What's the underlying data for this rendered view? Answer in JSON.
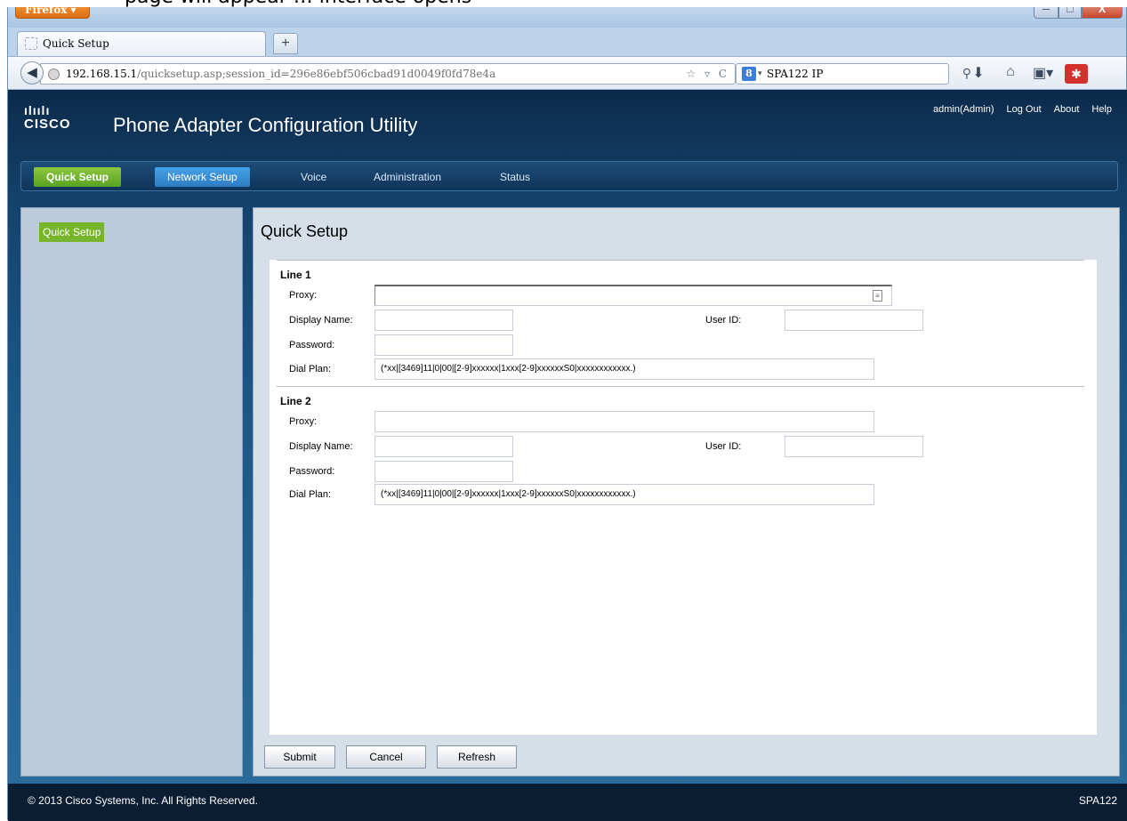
{
  "top_strip": {
    "text": "page will appear … interface opens"
  },
  "browser": {
    "app_button": "Firefox ▾",
    "tab_title": "Quick Setup",
    "new_tab": "+",
    "url_host": "192.168.15.1",
    "url_path": "/quicksetup.asp;session_id=296e86ebf506cbad91d0049f0fd78e4a",
    "url_tools": "☆ ▿ C",
    "search_engine": "8",
    "search_value": "SPA122 IP",
    "win_min": "─",
    "win_max": "□",
    "win_close": "X"
  },
  "header": {
    "logo_bars": "ılıılı",
    "logo_word": "CISCO",
    "title": "Phone Adapter Configuration Utility",
    "user": "admin(Admin)",
    "logout": "Log Out",
    "about": "About",
    "help": "Help"
  },
  "mainnav": {
    "quick_setup": "Quick Setup",
    "network_setup": "Network Setup",
    "voice": "Voice",
    "administration": "Administration",
    "status": "Status"
  },
  "sidebar": {
    "item": "Quick Setup"
  },
  "content": {
    "title": "Quick Setup",
    "line1": {
      "title": "Line 1",
      "proxy_label": "Proxy:",
      "proxy_value": "",
      "display_name_label": "Display Name:",
      "display_name_value": "",
      "user_id_label": "User ID:",
      "user_id_value": "",
      "password_label": "Password:",
      "password_value": "",
      "dial_plan_label": "Dial Plan:",
      "dial_plan_value": "(*xx|[3469]11|0|00|[2-9]xxxxxx|1xxx[2-9]xxxxxxS0|xxxxxxxxxxxx.)"
    },
    "line2": {
      "title": "Line 2",
      "proxy_label": "Proxy:",
      "proxy_value": "",
      "display_name_label": "Display Name:",
      "display_name_value": "",
      "user_id_label": "User ID:",
      "user_id_value": "",
      "password_label": "Password:",
      "password_value": "",
      "dial_plan_label": "Dial Plan:",
      "dial_plan_value": "(*xx|[3469]11|0|00|[2-9]xxxxxx|1xxx[2-9]xxxxxxS0|xxxxxxxxxxxx.)"
    },
    "buttons": {
      "submit": "Submit",
      "cancel": "Cancel",
      "refresh": "Refresh"
    }
  },
  "footer": {
    "copyright": "© 2013 Cisco Systems, Inc. All Rights Reserved.",
    "model": "SPA122"
  },
  "colors": {
    "accent_green": "#77b52c",
    "nav_selected_blue": "#3a8fd6",
    "page_blue": "#1b5584",
    "footer": "#0a1d33"
  }
}
